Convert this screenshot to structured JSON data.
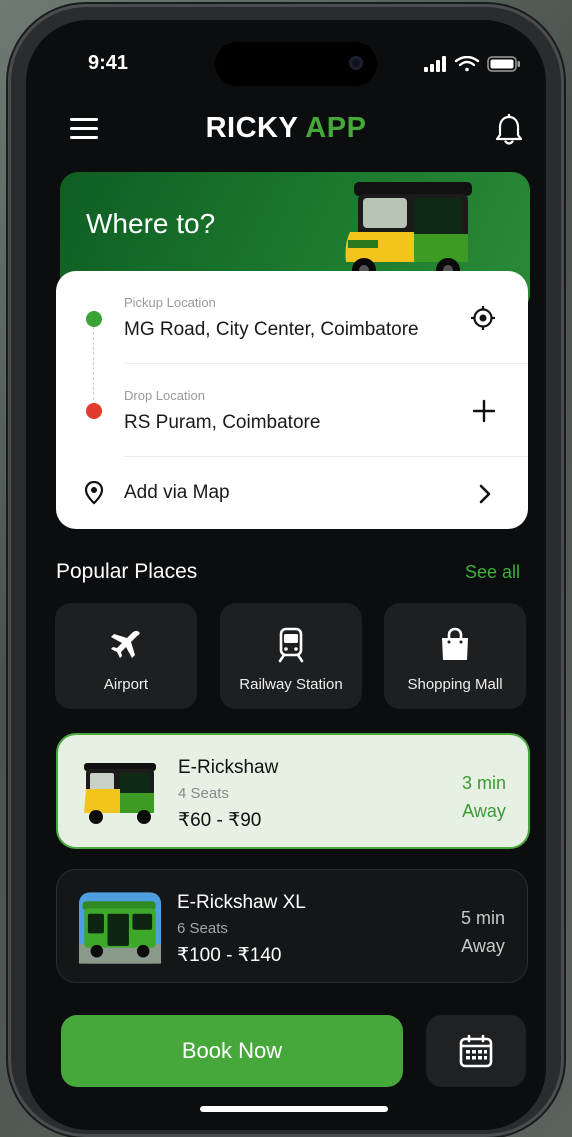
{
  "status_bar": {
    "time": "9:41"
  },
  "header": {
    "title_part1": "RICKY",
    "title_part2": "APP",
    "brand_color": "#46a83b"
  },
  "hero": {
    "title": "Where to?"
  },
  "locations": {
    "pickup_label": "Pickup Location",
    "pickup_value": "MG Road, City Center, Coimbatore",
    "drop_label": "Drop Location",
    "drop_value": "RS Puram, Coimbatore",
    "map_label": "Add via Map"
  },
  "popular": {
    "title": "Popular Places",
    "see_all": "See all",
    "places": [
      {
        "label": "Airport",
        "icon": "airplane-icon"
      },
      {
        "label": "Railway Station",
        "icon": "train-icon"
      },
      {
        "label": "Shopping Mall",
        "icon": "shopping-bag-icon"
      }
    ]
  },
  "rides": [
    {
      "name": "E-Rickshaw",
      "seats": "4 Seats",
      "price": "₹60 - ₹90",
      "eta_time": "3 min",
      "eta_label": "Away",
      "selected": true
    },
    {
      "name": "E-Rickshaw XL",
      "seats": "6 Seats",
      "price": "₹100 - ₹140",
      "eta_time": "5 min",
      "eta_label": "Away",
      "selected": false
    }
  ],
  "actions": {
    "book_now": "Book Now",
    "calendar_icon": "calendar-icon"
  }
}
